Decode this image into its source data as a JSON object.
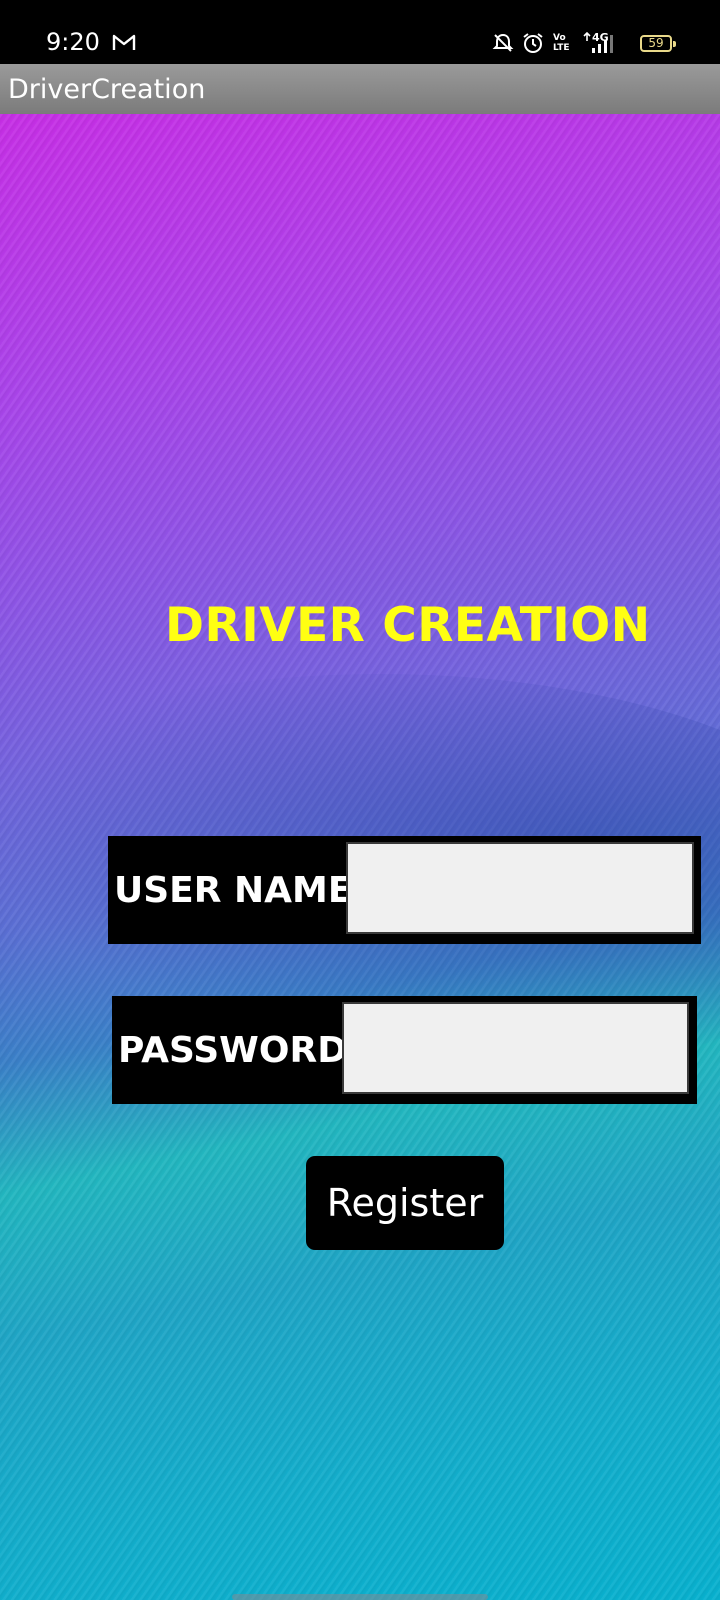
{
  "status_bar": {
    "time": "9:20",
    "battery_level": "59",
    "icons": [
      "gmail-icon",
      "do-not-disturb-icon",
      "alarm-icon",
      "volte-icon",
      "signal-4g-icon",
      "battery-icon"
    ],
    "volte_text": "Vo LTE",
    "network_text": "4G"
  },
  "app_bar": {
    "title": "DriverCreation"
  },
  "form": {
    "heading": "DRIVER CREATION",
    "username_label": "USER NAME",
    "username_value": "",
    "password_label": "PASSWORD",
    "password_value": "",
    "register_label": "Register"
  },
  "colors": {
    "heading": "#ffff12",
    "field_bg": "#000000",
    "input_bg": "#f0f0f0",
    "button_bg": "#000000",
    "app_bar": "#8a8a8a"
  }
}
